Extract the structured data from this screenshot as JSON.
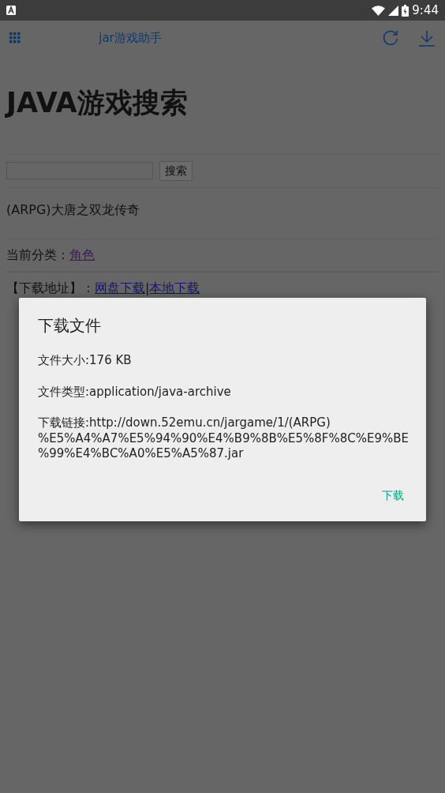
{
  "status_bar": {
    "time": "9:44"
  },
  "app_bar": {
    "title": "jar游戏助手"
  },
  "page": {
    "heading": "JAVA游戏搜索",
    "search": {
      "button": "搜索"
    },
    "game_title": "(ARPG)大唐之双龙传奇",
    "category": {
      "label": "当前分类：",
      "link": "角色",
      "visited": true
    },
    "downloads": {
      "label": "【下载地址】：",
      "separator": "|",
      "links": [
        {
          "text": "网盘下载",
          "visited": false
        },
        {
          "text": "本地下载",
          "visited": false
        }
      ]
    }
  },
  "dialog": {
    "title": "下载文件",
    "size": "文件大小:176 KB",
    "type": "文件类型:application/java-archive",
    "link_lines": [
      "下载链接:http://down.52emu.cn/jargame/1/(ARPG)",
      "%E5%A4%A7%E5%94%90%E4%B9%8B%E5%8F%8C%E9%BE",
      "%99%E4%BC%A0%E5%A5%87.jar"
    ],
    "button": "下载"
  }
}
